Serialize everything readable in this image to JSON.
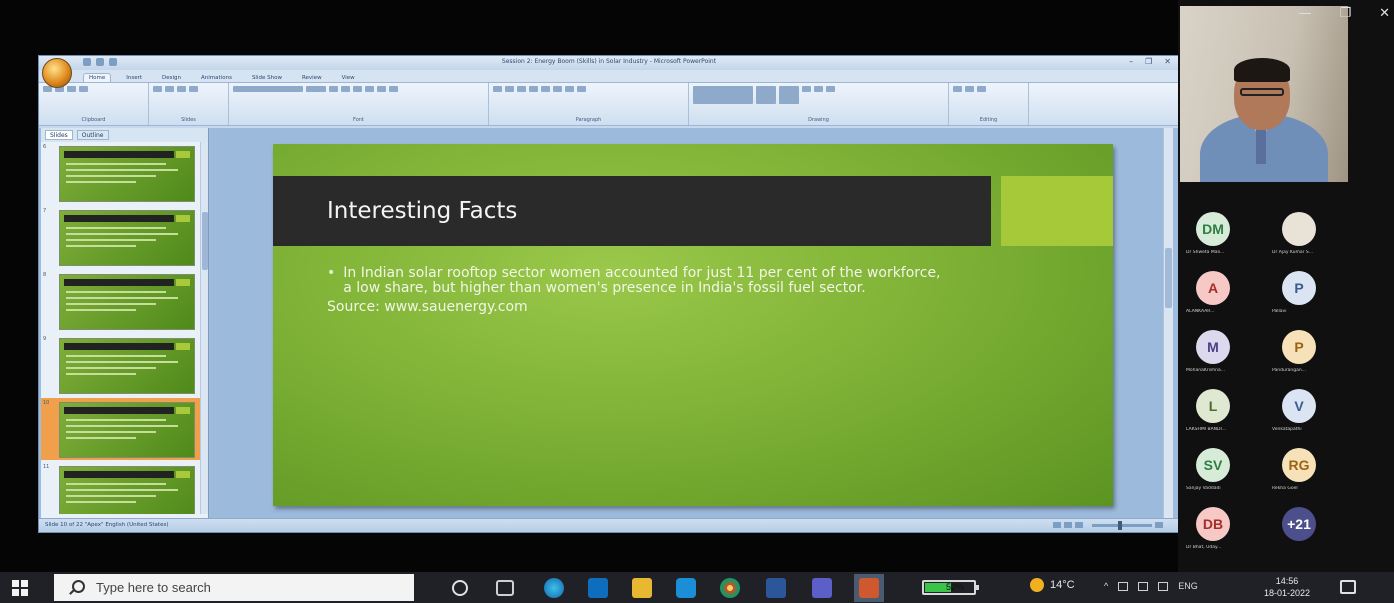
{
  "powerpoint": {
    "window_title": "Session 2: Energy Boom (Skills) in Solar Industry  -  Microsoft PowerPoint",
    "ribbon_tabs": [
      "Home",
      "Insert",
      "Design",
      "Animations",
      "Slide Show",
      "Review",
      "View"
    ],
    "ribbon_groups": [
      "Clipboard",
      "Slides",
      "Font",
      "Paragraph",
      "Drawing",
      "Editing"
    ],
    "pane_tabs": [
      "Slides",
      "Outline"
    ],
    "thumbnail_numbers": [
      "6",
      "7",
      "8",
      "9",
      "10",
      "11"
    ],
    "selected_thumbnail_index": 4,
    "status_text": "Slide 10 of 22    \"Apex\"    English (United States)",
    "slide": {
      "title": "Interesting Facts",
      "bullet": "In Indian solar rooftop sector women accounted for just 11 per cent of the workforce, a low share, but higher than women's presence in India's fossil fuel sector.",
      "source": "Source: www.sauenergy.com"
    }
  },
  "meeting": {
    "window_controls": [
      "—",
      "❐",
      "✕"
    ],
    "participants": [
      {
        "initials": "DM",
        "name": "Dr Shweta Mali...",
        "bg": "#d6ecd9",
        "fg": "#2e7d45"
      },
      {
        "initials": "",
        "name": "Dr Ajay Kumar S...",
        "bg": "#e9e2d6",
        "fg": "#333333"
      },
      {
        "initials": "A",
        "name": "ALANKAAR...",
        "bg": "#f6c9c7",
        "fg": "#a62d2a"
      },
      {
        "initials": "P",
        "name": "Pallavi",
        "bg": "#dbe4f2",
        "fg": "#3b5a8f"
      },
      {
        "initials": "M",
        "name": "MohanaKrishna...",
        "bg": "#dcd8ee",
        "fg": "#4a3f82"
      },
      {
        "initials": "P",
        "name": "Pandurangan...",
        "bg": "#f7e1b9",
        "fg": "#9a6412"
      },
      {
        "initials": "L",
        "name": "LAKSHMI BANDI...",
        "bg": "#dfe9d2",
        "fg": "#4d6b2c"
      },
      {
        "initials": "V",
        "name": "Venkatapathi",
        "bg": "#dbe4f2",
        "fg": "#3b5a8f"
      },
      {
        "initials": "SV",
        "name": "Sanjay Vaddadi",
        "bg": "#d6ecd9",
        "fg": "#2e7d45"
      },
      {
        "initials": "RG",
        "name": "Rekha Goel",
        "bg": "#f7e1b9",
        "fg": "#9a6412"
      },
      {
        "initials": "DB",
        "name": "Dr Bhat, Uday...",
        "bg": "#f6c9c7",
        "fg": "#a62d2a"
      },
      {
        "initials": "+21",
        "name": "",
        "bg": "#4d4f8c",
        "fg": "#ffffff"
      }
    ]
  },
  "taskbar": {
    "search_placeholder": "Type here to search",
    "battery": "52%",
    "battery_level": 0.52,
    "weather": "14°C",
    "language": "ENG",
    "time": "14:56",
    "date": "18-01-2022"
  }
}
